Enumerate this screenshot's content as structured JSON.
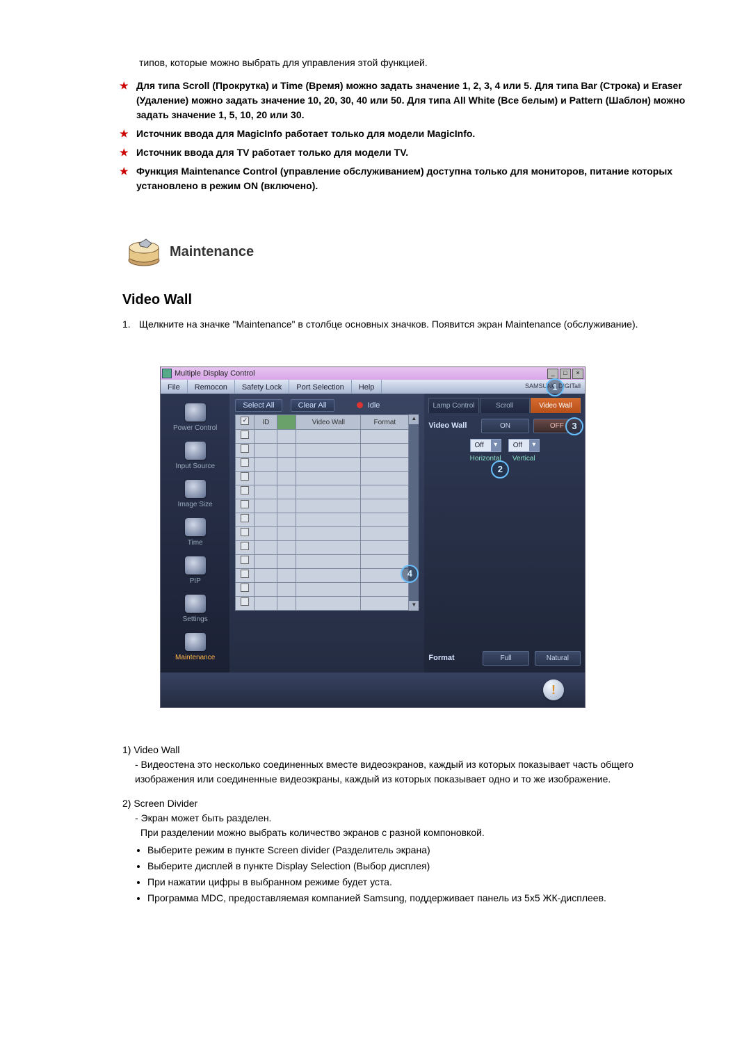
{
  "intro_line": "типов, которые можно выбрать для управления этой функцией.",
  "notes": [
    "Для типа Scroll (Прокрутка) и Time (Время) можно задать значение 1, 2, 3, 4 или 5. Для типа Bar (Строка) и Eraser (Удаление) можно задать значение 10, 20, 30, 40 или 50. Для типа All White (Все белым) и Pattern (Шаблон) можно задать значение 1, 5, 10, 20 или 30.",
    "Источник ввода для MagicInfo работает только для модели MagicInfo.",
    "Источник ввода для TV работает только для модели TV.",
    "Функция Maintenance Control (управление обслуживанием) доступна только для мониторов, питание которых установлено в режим ON (включено)."
  ],
  "section_title": "Maintenance",
  "subsection_title": "Video Wall",
  "numbered_intro": {
    "num": "1.",
    "text": "Щелкните на значке \"Maintenance\" в столбце основных значков. Появится экран Maintenance (обслуживание)."
  },
  "app": {
    "title": "Multiple Display Control",
    "menu": [
      "File",
      "Remocon",
      "Safety Lock",
      "Port Selection",
      "Help"
    ],
    "brand": "SAMSUNG DIGITall",
    "sidebar": [
      "Power Control",
      "Input Source",
      "Image Size",
      "Time",
      "PIP",
      "Settings",
      "Maintenance"
    ],
    "buttons": {
      "select_all": "Select All",
      "clear_all": "Clear All"
    },
    "idle": "Idle",
    "grid_headers": {
      "id": "ID",
      "video_wall": "Video Wall",
      "format": "Format"
    },
    "tabs": {
      "lamp": "Lamp Control",
      "scroll": "Scroll",
      "video_wall": "Video Wall"
    },
    "panel": {
      "video_wall_label": "Video Wall",
      "on": "ON",
      "off": "OFF",
      "h_value": "Off",
      "v_value": "Off",
      "h_label": "Horizontal",
      "v_label": "Vertical",
      "format_label": "Format",
      "full": "Full",
      "natural": "Natural"
    },
    "callouts": {
      "c1": "1",
      "c2": "2",
      "c3": "3",
      "c4": "4"
    }
  },
  "descriptions": [
    {
      "num": "1)",
      "title": "Video Wall",
      "lines": [
        "- Видеостена это несколько соединенных вместе видеоэкранов, каждый из которых показывает часть общего изображения или соединенные видеоэкраны, каждый из которых показывает одно и то же изображение."
      ],
      "bullets": []
    },
    {
      "num": "2)",
      "title": "Screen Divider",
      "lines": [
        "- Экран может быть разделен.",
        "При разделении можно выбрать количество экранов с разной компоновкой."
      ],
      "bullets": [
        "Выберите режим в пункте Screen divider (Разделитель экрана)",
        "Выберите дисплей в пункте Display Selection (Выбор дисплея)",
        "При нажатии цифры в выбранном режиме будет уста.",
        "Программа MDC, предоставляемая компанией Samsung, поддерживает панель из 5x5 ЖК-дисплеев."
      ]
    }
  ]
}
